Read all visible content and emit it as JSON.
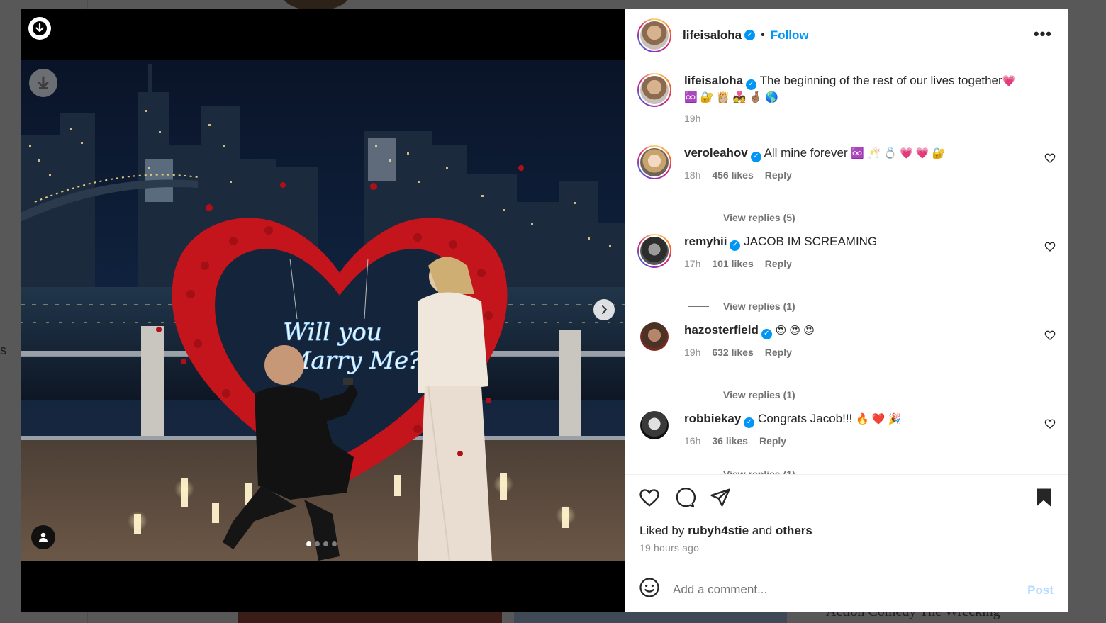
{
  "background": {
    "sidebar_fragment": "s",
    "thumbnail_text": "Action Comedy The Wrecking"
  },
  "post": {
    "author": "lifeisaloha",
    "follow_label": "Follow",
    "separator": "•",
    "more_label": "•••",
    "caption": {
      "username": "lifeisaloha",
      "text": "The beginning of the rest of our lives together",
      "emoji_line1": "💗",
      "emoji_line2": "♾️ 🔐 👸🏼 💑 🤞🏽 🌎",
      "time": "19h"
    },
    "carousel": {
      "slide_count": 4,
      "active_index": 0
    },
    "neon_text_1": "Will you",
    "neon_text_2": "Marry Me?"
  },
  "comments": [
    {
      "username": "veroleahov",
      "text": "All mine forever",
      "emojis": "♾️ 🥂 💍 💗 💗 🔐",
      "time": "18h",
      "likes": "456 likes",
      "reply": "Reply",
      "view_replies": "View replies (5)"
    },
    {
      "username": "remyhii",
      "text": "JACOB IM SCREAMING",
      "emojis": "",
      "time": "17h",
      "likes": "101 likes",
      "reply": "Reply",
      "view_replies": "View replies (1)"
    },
    {
      "username": "hazosterfield",
      "text": "",
      "emojis": "😍 😍 😍",
      "time": "19h",
      "likes": "632 likes",
      "reply": "Reply",
      "view_replies": "View replies (1)"
    },
    {
      "username": "robbiekay",
      "text": "Congrats Jacob!!!",
      "emojis": "🔥 ❤️ 🎉",
      "time": "16h",
      "likes": "36 likes",
      "reply": "Reply",
      "view_replies": "View replies (1)"
    }
  ],
  "actions": {
    "liked_by_prefix": "Liked by",
    "liked_by_user": "rubyh4stie",
    "liked_by_and": "and",
    "liked_by_others": "others",
    "time_ago": "19 hours ago"
  },
  "comment_box": {
    "placeholder": "Add a comment...",
    "post_label": "Post"
  },
  "colors": {
    "accent": "#0095f6",
    "post_disabled": "#b3dbff",
    "rose_red": "#c4141c",
    "neon": "#e8f6ff"
  }
}
